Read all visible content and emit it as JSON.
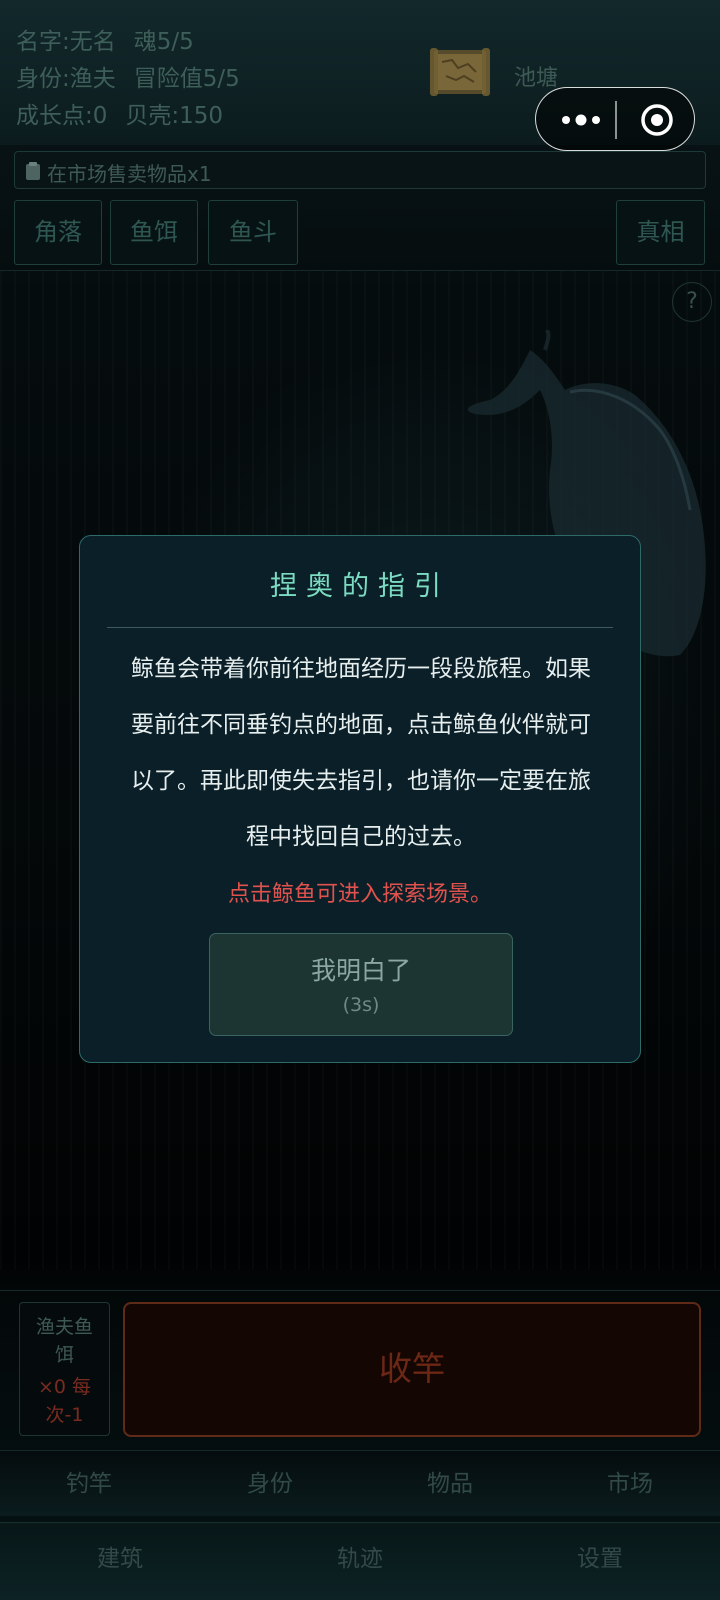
{
  "status": {
    "name": "名字:无名",
    "soul": "魂5/5",
    "identity": "身份:渔夫",
    "adventure": "冒险值5/5",
    "growth": "成长点:0",
    "shells": "贝壳:150"
  },
  "location": {
    "icon": "map-scroll-icon",
    "name": "池塘"
  },
  "task": {
    "icon": "clipboard-icon",
    "text": "在市场售卖物品x1"
  },
  "tabs": [
    "角落",
    "鱼饵",
    "鱼斗"
  ],
  "truth_button": "真相",
  "help": "?",
  "dialog": {
    "title": "捏奥的指引",
    "body_lines": [
      "鲸鱼会带着你前往地面经历一段段旅程。如果",
      "要前往不同垂钓点的地面，点击鲸鱼伙伴就可",
      "以了。再此即使失去指引，也请你一定要在旅",
      "程中找回自己的过去。"
    ],
    "hint": "点击鲸鱼可进入探索场景。",
    "confirm_label": "我明白了",
    "countdown": "(3s)"
  },
  "bait": {
    "name_lines": [
      "渔夫鱼",
      "饵"
    ],
    "stock_lines": [
      "×0  每",
      "次-1"
    ]
  },
  "reel_button": "收竿",
  "nav_row1": [
    "钓竿",
    "身份",
    "物品",
    "市场"
  ],
  "nav_row2": [
    "建筑",
    "轨迹",
    "设置"
  ],
  "colors": {
    "accent_teal": "#7bdcc2",
    "hint_red": "#e0524d",
    "reel_brown": "#6c2715",
    "dialog_bg": "#0b1f28"
  }
}
